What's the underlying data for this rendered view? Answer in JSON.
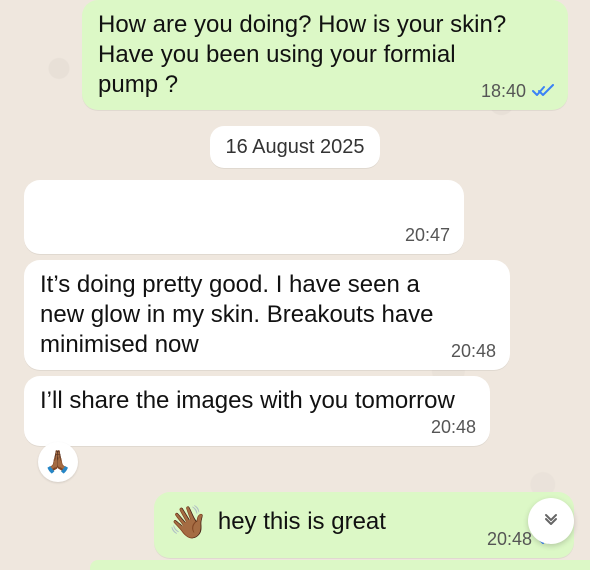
{
  "messages": [
    {
      "id": "m1",
      "direction": "outgoing",
      "text": "How are you doing? How is your skin?\nHave you been using your formial\npump ?",
      "time": "18:40",
      "status_icon": "double-check-icon",
      "status_color": "#3B82F6"
    },
    {
      "id": "m2",
      "direction": "incoming",
      "text": "",
      "time": "20:47"
    },
    {
      "id": "m3",
      "direction": "incoming",
      "text": "It’s doing pretty good. I have seen a\nnew glow in my skin. Breakouts have\nminimised now",
      "time": "20:48"
    },
    {
      "id": "m4",
      "direction": "incoming",
      "text": "I’ll share the images with you tomorrow",
      "time": "20:48",
      "reaction": "🙏🏾"
    },
    {
      "id": "m5",
      "direction": "outgoing",
      "emoji": "👋🏾",
      "text": "hey this is great",
      "time": "20:48",
      "status_icon": "double-check-icon",
      "status_color": "#3B82F6"
    }
  ],
  "date_separator": {
    "label": "16 August 2025"
  },
  "ui": {
    "scroll_to_bottom_icon": "double-chevron-down-icon"
  },
  "colors": {
    "outgoing_bubble": "#DCF8C6",
    "incoming_bubble": "#FFFFFF",
    "background": "#EFE7DE"
  }
}
